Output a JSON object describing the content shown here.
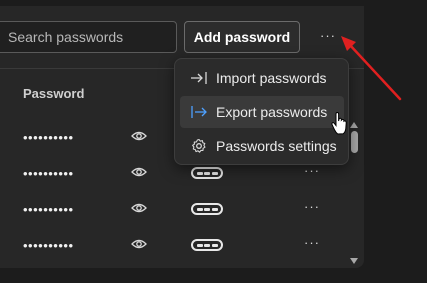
{
  "toolbar": {
    "search_placeholder": "Search passwords",
    "add_label": "Add password",
    "more_label": "···"
  },
  "table": {
    "column_password": "Password",
    "rows": [
      {
        "password": "••••••••••",
        "more": "···"
      },
      {
        "password": "••••••••••",
        "more": "···"
      },
      {
        "password": "••••••••••",
        "more": "···"
      },
      {
        "password": "••••••••••",
        "more": "···"
      }
    ]
  },
  "menu": {
    "items": [
      {
        "label": "Import passwords",
        "icon": "import-icon",
        "highlighted": false
      },
      {
        "label": "Export passwords",
        "icon": "export-icon",
        "highlighted": true
      },
      {
        "label": "Passwords settings",
        "icon": "gear-icon",
        "highlighted": false
      }
    ]
  },
  "colors": {
    "annotation_arrow": "#e02020",
    "export_icon_accent": "#4ea1ff"
  }
}
